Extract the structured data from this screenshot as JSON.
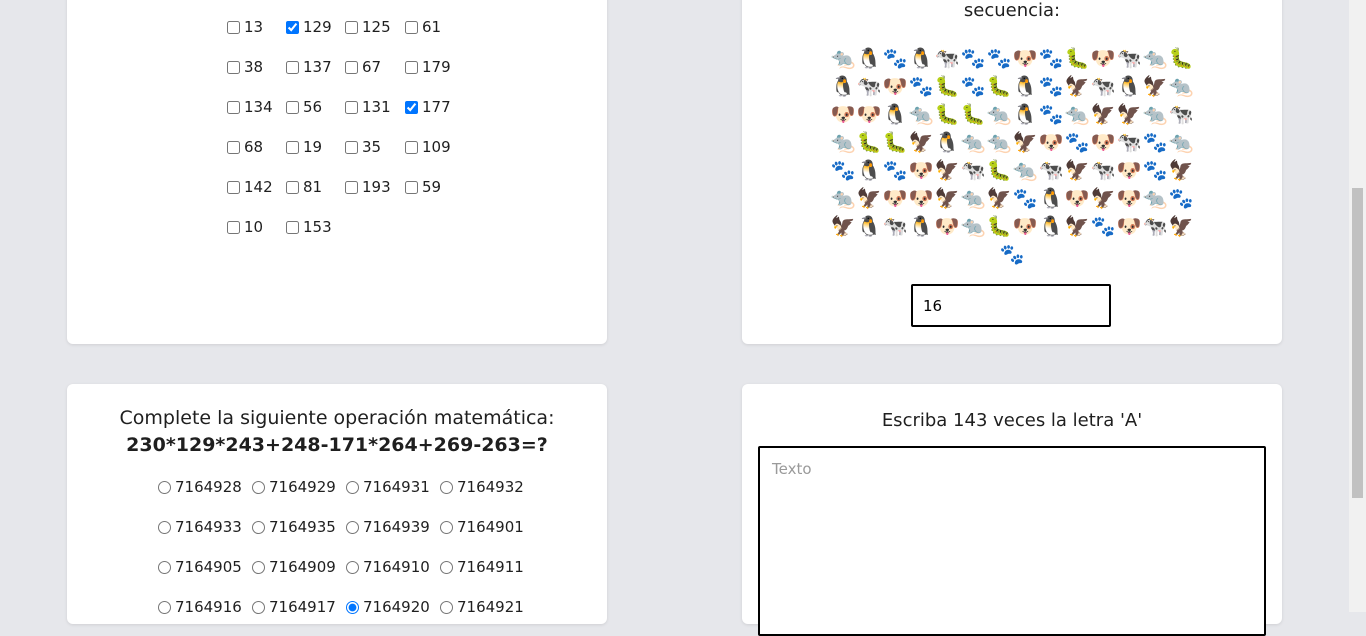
{
  "checkbox_section": {
    "options": [
      {
        "label": "13",
        "checked": false
      },
      {
        "label": "129",
        "checked": true
      },
      {
        "label": "125",
        "checked": false
      },
      {
        "label": "61",
        "checked": false
      },
      {
        "label": "38",
        "checked": false
      },
      {
        "label": "137",
        "checked": false
      },
      {
        "label": "67",
        "checked": false
      },
      {
        "label": "179",
        "checked": false
      },
      {
        "label": "134",
        "checked": false
      },
      {
        "label": "56",
        "checked": false
      },
      {
        "label": "131",
        "checked": false
      },
      {
        "label": "177",
        "checked": true
      },
      {
        "label": "68",
        "checked": false
      },
      {
        "label": "19",
        "checked": false
      },
      {
        "label": "35",
        "checked": false
      },
      {
        "label": "109",
        "checked": false
      },
      {
        "label": "142",
        "checked": false
      },
      {
        "label": "81",
        "checked": false
      },
      {
        "label": "193",
        "checked": false
      },
      {
        "label": "59",
        "checked": false
      },
      {
        "label": "10",
        "checked": false
      },
      {
        "label": "153",
        "checked": false
      }
    ]
  },
  "sequence_section": {
    "title": "secuencia:",
    "icons": [
      "rat-icon",
      "penguin-icon",
      "paw-icon",
      "penguin-icon",
      "cow-icon",
      "paw-icon",
      "paw-icon",
      "dog-icon",
      "paw-icon",
      "caterpillar-icon",
      "dog-icon",
      "cow-icon",
      "rat-icon",
      "caterpillar-icon",
      "penguin-icon",
      "cow-icon",
      "dog-icon",
      "paw-icon",
      "caterpillar-icon",
      "paw-icon",
      "caterpillar-icon",
      "penguin-icon",
      "paw-icon",
      "eagle-icon",
      "cow-icon",
      "penguin-icon",
      "eagle-icon",
      "rat-icon",
      "dog-icon",
      "dog-icon",
      "penguin-icon",
      "rat-icon",
      "caterpillar-icon",
      "caterpillar-icon",
      "rat-icon",
      "penguin-icon",
      "paw-icon",
      "rat-icon",
      "eagle-icon",
      "eagle-icon",
      "rat-icon",
      "cow-icon",
      "rat-icon",
      "caterpillar-icon",
      "caterpillar-icon",
      "eagle-icon",
      "penguin-icon",
      "rat-icon",
      "rat-icon",
      "eagle-icon",
      "dog-icon",
      "paw-icon",
      "dog-icon",
      "cow-icon",
      "paw-icon",
      "rat-icon",
      "paw-icon",
      "penguin-icon",
      "paw-icon",
      "dog-icon",
      "eagle-icon",
      "cow-icon",
      "caterpillar-icon",
      "rat-icon",
      "cow-icon",
      "eagle-icon",
      "cow-icon",
      "dog-icon",
      "paw-icon",
      "eagle-icon",
      "rat-icon",
      "eagle-icon",
      "dog-icon",
      "dog-icon",
      "eagle-icon",
      "rat-icon",
      "eagle-icon",
      "paw-icon",
      "penguin-icon",
      "dog-icon",
      "eagle-icon",
      "dog-icon",
      "rat-icon",
      "paw-icon",
      "eagle-icon",
      "penguin-icon",
      "cow-icon",
      "penguin-icon",
      "dog-icon",
      "rat-icon",
      "caterpillar-icon",
      "dog-icon",
      "penguin-icon",
      "eagle-icon",
      "paw-icon",
      "dog-icon",
      "cow-icon",
      "eagle-icon",
      "paw-icon"
    ],
    "answer_value": "16"
  },
  "math_section": {
    "title": "Complete la siguiente operación matemática:",
    "expression": "230*129*243+248-171*264+269-263=?",
    "options": [
      {
        "label": "7164928",
        "selected": false
      },
      {
        "label": "7164929",
        "selected": false
      },
      {
        "label": "7164931",
        "selected": false
      },
      {
        "label": "7164932",
        "selected": false
      },
      {
        "label": "7164933",
        "selected": false
      },
      {
        "label": "7164935",
        "selected": false
      },
      {
        "label": "7164939",
        "selected": false
      },
      {
        "label": "7164901",
        "selected": false
      },
      {
        "label": "7164905",
        "selected": false
      },
      {
        "label": "7164909",
        "selected": false
      },
      {
        "label": "7164910",
        "selected": false
      },
      {
        "label": "7164911",
        "selected": false
      },
      {
        "label": "7164916",
        "selected": false
      },
      {
        "label": "7164917",
        "selected": false
      },
      {
        "label": "7164920",
        "selected": true
      },
      {
        "label": "7164921",
        "selected": false
      }
    ]
  },
  "text_section": {
    "title": "Escriba 143 veces la letra 'A'",
    "placeholder": "Texto",
    "value": ""
  },
  "icon_glyphs": {
    "rat-icon": "🐀",
    "penguin-icon": "🐧",
    "paw-icon": "🐾",
    "cow-icon": "🐄",
    "dog-icon": "🐶",
    "caterpillar-icon": "🐛",
    "eagle-icon": "🦅"
  }
}
